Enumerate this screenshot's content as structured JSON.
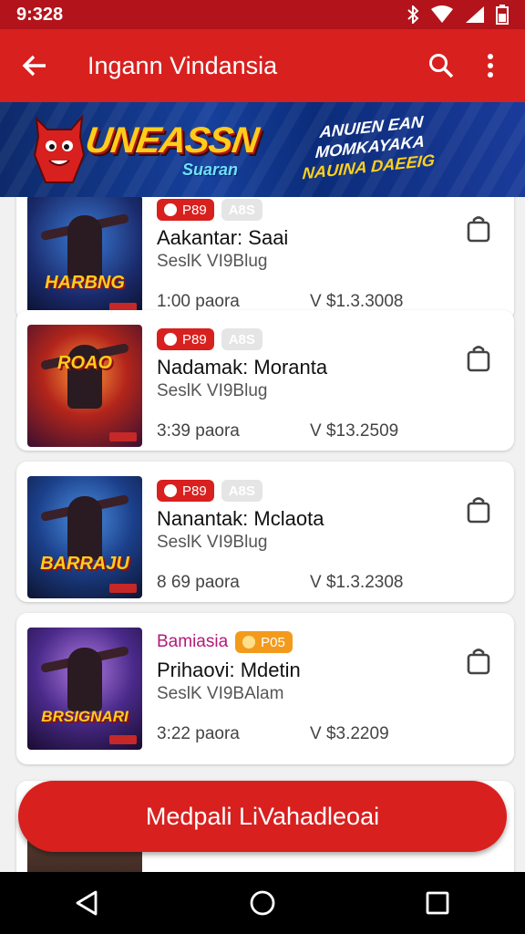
{
  "status_bar": {
    "time": "9:328"
  },
  "app_bar": {
    "title": "Ingann Vindansia"
  },
  "banner": {
    "logo_main": "UNEASSN",
    "logo_sub": "Suaran",
    "promo_line1": "ANUIEN EAN",
    "promo_line2": "MOMKAYAKA",
    "promo_line3": "NAUINA DAEEIG"
  },
  "items": [
    {
      "badge1": "P89",
      "badge2": "A8S",
      "name": "Aakantar: Saai",
      "seller": "SeslK VI9Blug",
      "time": "1:00 paora",
      "price": "V $1.3.3008",
      "art_text": "HARBNG"
    },
    {
      "badge1": "P89",
      "badge2": "A8S",
      "name": "Nadamak: Moranta",
      "seller": "SeslK VI9Blug",
      "time": "3:39 paora",
      "price": "V $13.2509",
      "art_text": "ROAO"
    },
    {
      "badge1": "P89",
      "badge2": "A8S",
      "name": "Nanantak: Mclaota",
      "seller": "SeslK VI9Blug",
      "time": "8 69 paora",
      "price": "V $1.3.2308",
      "art_text": "BARRAJU"
    },
    {
      "genre": "Bamiasia",
      "badge1": "P05",
      "name": "Prihaovi: Mdetin",
      "seller": "SeslK VI9BAlam",
      "time": "3:22 paora",
      "price": "V $3.2209",
      "art_text": "BRSIGNARI"
    }
  ],
  "cta": {
    "label": "Medpali LiVahadleoai"
  },
  "colors": {
    "primary": "#d8201f",
    "status_bar": "#b3141b",
    "genre": "#b51877",
    "badge_orange": "#f39a1c"
  },
  "icons": [
    "back-arrow-icon",
    "search-icon",
    "more-vert-icon",
    "bluetooth-icon",
    "wifi-icon",
    "signal-icon",
    "battery-icon",
    "shopping-bag-icon",
    "nav-back-icon",
    "nav-home-icon",
    "nav-recents-icon"
  ]
}
